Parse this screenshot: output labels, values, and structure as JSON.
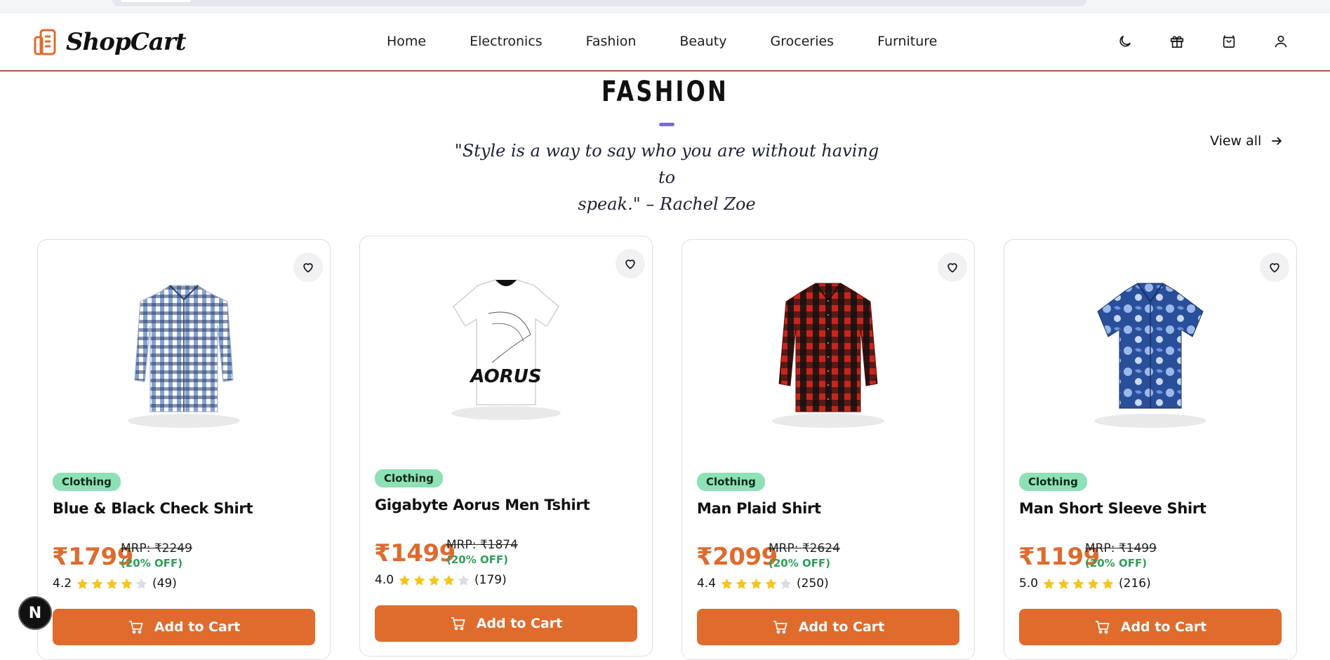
{
  "brand": {
    "name": "ShopCart",
    "accent": "#df6b2d"
  },
  "nav": {
    "links": [
      "Home",
      "Electronics",
      "Fashion",
      "Beauty",
      "Groceries",
      "Furniture"
    ],
    "icons": [
      "moon-icon",
      "gift-icon",
      "shopping-bag-icon",
      "user-icon"
    ]
  },
  "section": {
    "title": "FASHION",
    "quote_line1": "\"Style is a way to say who you are without having to",
    "quote_line2": "speak.\" – Rachel Zoe",
    "view_all": "View all"
  },
  "products": [
    {
      "category": "Clothing",
      "name": "Blue & Black Check Shirt",
      "price": "₹1799",
      "mrp": "MRP: ₹2249",
      "discount": "(20% OFF)",
      "rating": "4.2",
      "stars": 4,
      "reviews": "(49)",
      "cta": "Add to Cart",
      "image": "blue-check-shirt"
    },
    {
      "category": "Clothing",
      "name": "Gigabyte Aorus Men Tshirt",
      "price": "₹1499",
      "mrp": "MRP: ₹1874",
      "discount": "(20% OFF)",
      "rating": "4.0",
      "stars": 4,
      "reviews": "(179)",
      "cta": "Add to Cart",
      "image": "white-aorus-tshirt"
    },
    {
      "category": "Clothing",
      "name": "Man Plaid Shirt",
      "price": "₹2099",
      "mrp": "MRP: ₹2624",
      "discount": "(20% OFF)",
      "rating": "4.4",
      "stars": 4,
      "reviews": "(250)",
      "cta": "Add to Cart",
      "image": "red-plaid-shirt"
    },
    {
      "category": "Clothing",
      "name": "Man Short Sleeve Shirt",
      "price": "₹1199",
      "mrp": "MRP: ₹1499",
      "discount": "(20% OFF)",
      "rating": "5.0",
      "stars": 5,
      "reviews": "(216)",
      "cta": "Add to Cart",
      "image": "blue-floral-shirt"
    }
  ],
  "dev_badge": "N"
}
